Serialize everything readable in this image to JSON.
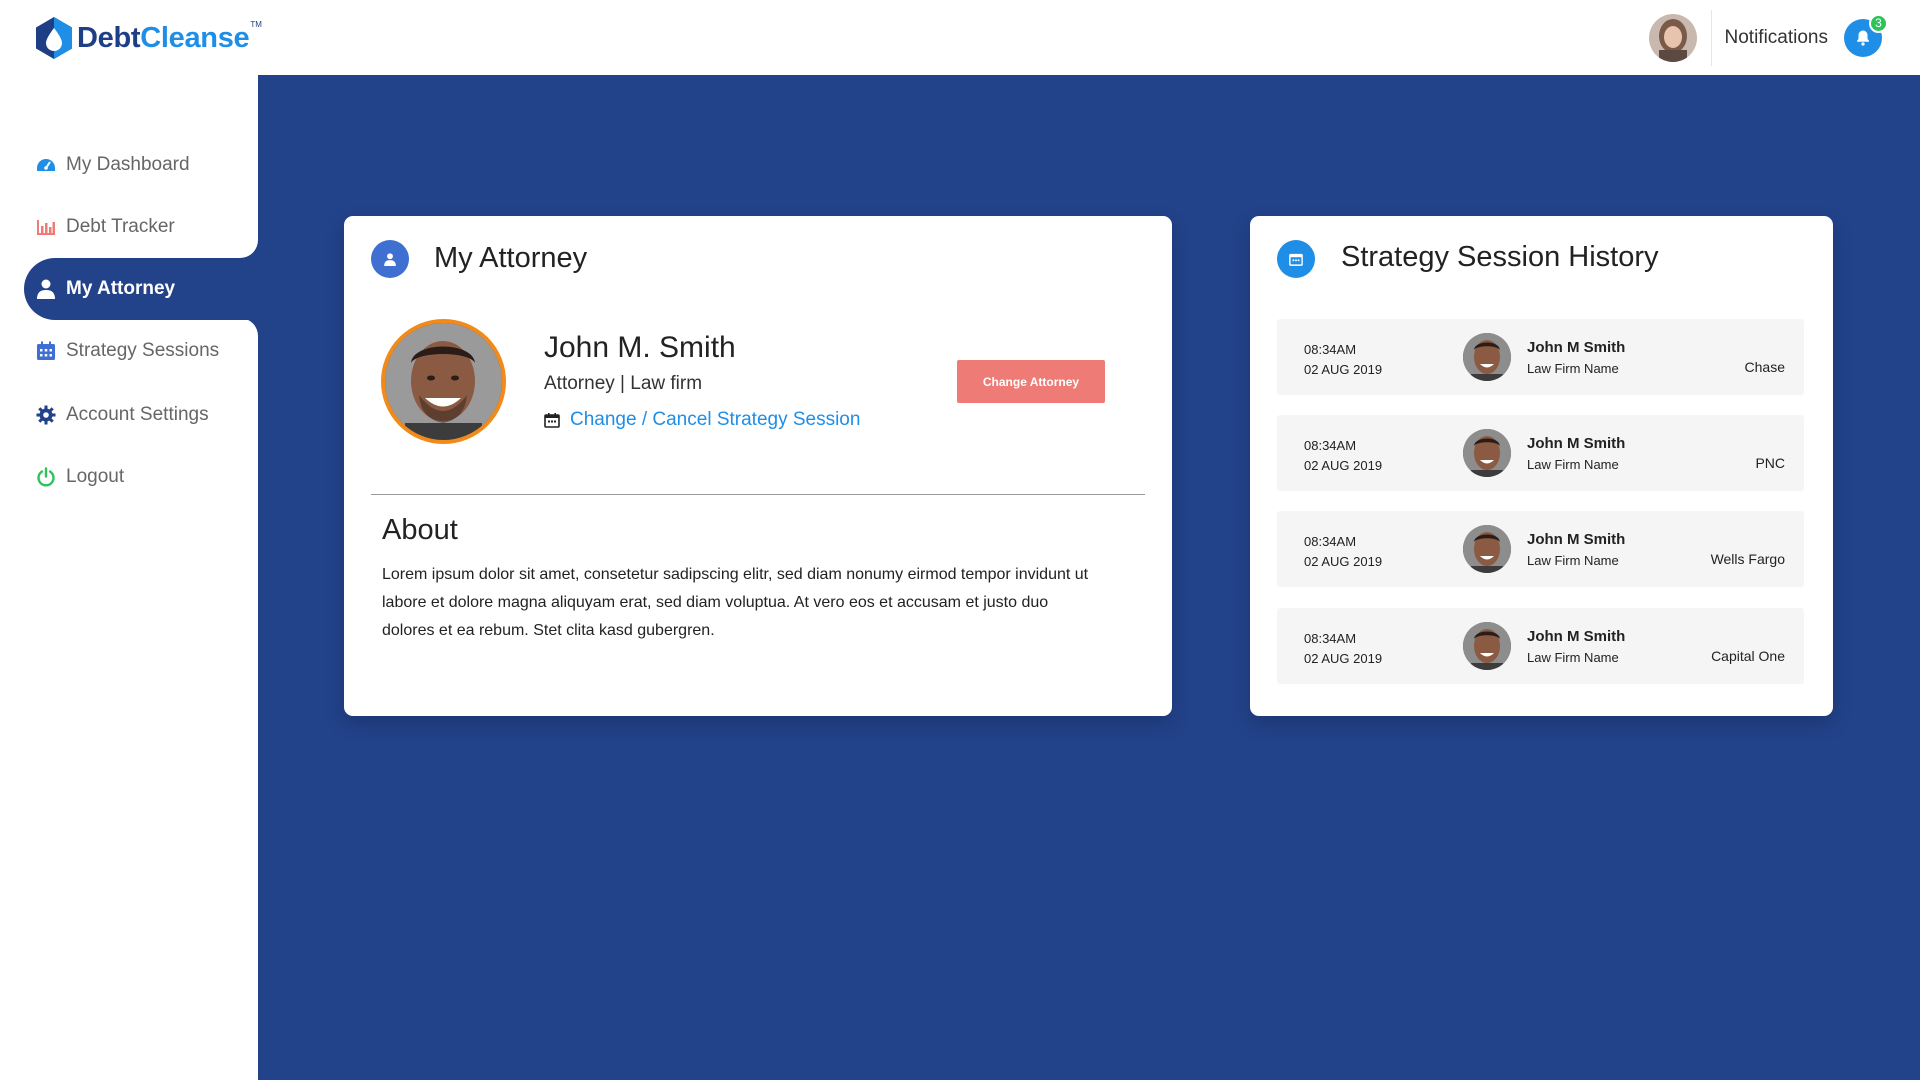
{
  "brand": {
    "name_part1": "Debt",
    "name_part2": "Cleanse",
    "tm": "TM"
  },
  "header": {
    "notifications_label": "Notifications",
    "notification_count": "3"
  },
  "sidebar": {
    "items": [
      {
        "label": "My Dashboard",
        "icon": "dashboard-gauge-icon"
      },
      {
        "label": "Debt Tracker",
        "icon": "bar-chart-icon"
      },
      {
        "label": "My Attorney",
        "icon": "user-icon",
        "active": true
      },
      {
        "label": "Strategy Sessions",
        "icon": "calendar-icon"
      },
      {
        "label": "Account Settings",
        "icon": "gear-icon"
      },
      {
        "label": "Logout",
        "icon": "power-icon"
      }
    ]
  },
  "attorney_card": {
    "title": "My Attorney",
    "name": "John M. Smith",
    "role": "Attorney | Law firm",
    "session_link": "Change / Cancel Strategy Session",
    "change_button": "Change Attorney",
    "about_title": "About",
    "about_text": "Lorem ipsum dolor sit amet, consetetur sadipscing elitr, sed diam nonumy eirmod tempor invidunt ut labore et dolore magna aliquyam erat, sed diam voluptua. At vero eos et accusam et justo duo dolores et ea rebum. Stet clita kasd gubergren."
  },
  "history_card": {
    "title": "Strategy Session History",
    "sessions": [
      {
        "time": "08:34AM",
        "date": "02 AUG 2019",
        "name": "John M Smith",
        "firm": "Law Firm Name",
        "bank": "Chase"
      },
      {
        "time": "08:34AM",
        "date": "02 AUG 2019",
        "name": "John M Smith",
        "firm": "Law Firm Name",
        "bank": "PNC"
      },
      {
        "time": "08:34AM",
        "date": "02 AUG 2019",
        "name": "John M Smith",
        "firm": "Law Firm Name",
        "bank": "Wells Fargo"
      },
      {
        "time": "08:34AM",
        "date": "02 AUG 2019",
        "name": "John M Smith",
        "firm": "Law Firm Name",
        "bank": "Capital One"
      }
    ]
  },
  "colors": {
    "primary_blue": "#22428a",
    "accent_blue": "#1f8ee6",
    "button_coral": "#ee7b75",
    "avatar_ring": "#f28a1a",
    "badge_green": "#2ec35a"
  }
}
